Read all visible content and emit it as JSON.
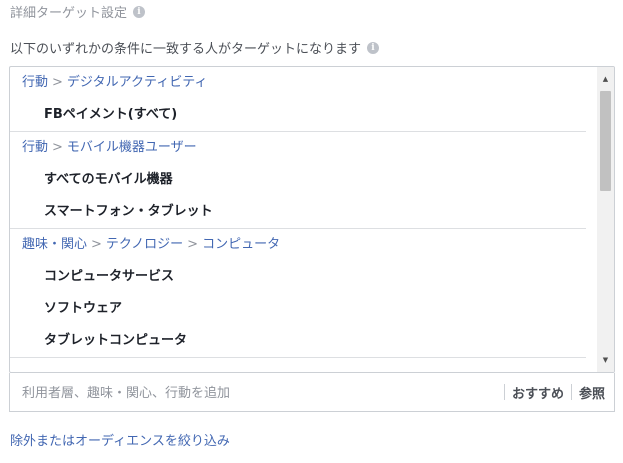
{
  "heading": {
    "title": "詳細ターゲット設定",
    "info_glyph": "i"
  },
  "subheading": {
    "text": "以下のいずれかの条件に一致する人がターゲットになります",
    "info_glyph": "i"
  },
  "groups": [
    {
      "path": [
        "行動",
        "デジタルアクティビティ"
      ],
      "items": [
        "FBペイメント(すべて)"
      ]
    },
    {
      "path": [
        "行動",
        "モバイル機器ユーザー"
      ],
      "items": [
        "すべてのモバイル機器",
        "スマートフォン・タブレット"
      ]
    },
    {
      "path": [
        "趣味・関心",
        "テクノロジー",
        "コンピュータ"
      ],
      "items": [
        "コンピュータサービス",
        "ソフトウェア",
        "タブレットコンピュータ"
      ]
    }
  ],
  "path_separator": ">",
  "search": {
    "placeholder": "利用者層、趣味・関心、行動を追加",
    "recommend_label": "おすすめ",
    "browse_label": "参照"
  },
  "footer": {
    "prefix": "除外または",
    "link": "オーディエンスを絞り込み"
  },
  "scrollbar": {
    "up_glyph": "▲",
    "down_glyph": "▼"
  }
}
